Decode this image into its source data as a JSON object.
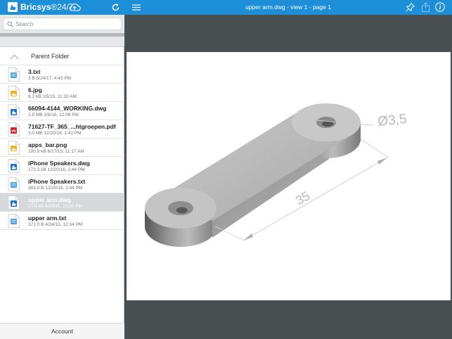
{
  "app": {
    "brand_name": "Bricsys",
    "brand_suffix": "®24/7"
  },
  "search": {
    "placeholder": "Search"
  },
  "parent_folder": {
    "label": "Parent Folder"
  },
  "files": [
    {
      "name": "3.txt",
      "meta": "3 B 5/24/17, 4:43 PM",
      "icon": "text-file-icon"
    },
    {
      "name": "6.jpg",
      "meta": "8.2 kB 1/5/15, 11:20 AM",
      "icon": "image-file-icon"
    },
    {
      "name": "66094-4144_WORKING.dwg",
      "meta": "1.9 MB 1/8/16, 12:06 PM",
      "icon": "dwg-file-icon"
    },
    {
      "name": "71627-TF_365_...htgroepen.pdf",
      "meta": "3.0 MB 12/20/16, 1:41 PM",
      "icon": "pdf-file-icon"
    },
    {
      "name": "apps_bar.png",
      "meta": "100.9 kB 6/17/15, 11:17 AM",
      "icon": "image-file-icon"
    },
    {
      "name": "iPhone Speakers.dwg",
      "meta": "173.3 kB 12/20/16, 2:44 PM",
      "icon": "dwg-file-icon"
    },
    {
      "name": "iPhone Speakers.txt",
      "meta": "383.0 B 12/20/16, 2:44 PM",
      "icon": "text-file-icon"
    },
    {
      "name": "upper arm.dwg",
      "meta": "27.4 kB 4/24/15, 12:34 PM",
      "icon": "dwg-file-icon",
      "selected": true
    },
    {
      "name": "upper arm.txt",
      "meta": "371.0 B 4/24/15, 12:34 PM",
      "icon": "text-file-icon"
    }
  ],
  "account": {
    "label": "Account"
  },
  "viewer": {
    "title": "upper arm.dwg - view 1 - page 1",
    "dimension_diameter": "Ø3,5",
    "dimension_length": "35"
  },
  "colors": {
    "header_blue": "#1d8fd9",
    "canvas_gray": "#4a4f52",
    "selected_row": "#d6d8d9"
  }
}
